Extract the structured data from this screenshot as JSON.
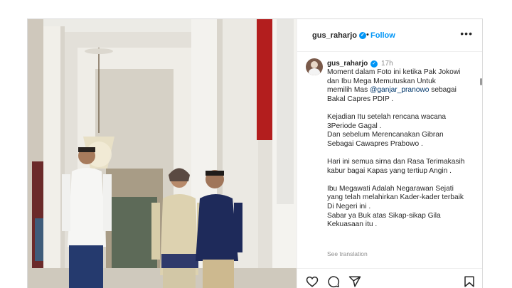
{
  "post": {
    "username": "gus_raharjo",
    "follow_label": "Follow",
    "dot_separator": "•",
    "more_label": "•••"
  },
  "caption": {
    "username": "gus_raharjo",
    "time": "17h",
    "mention": "@ganjar_pranowo",
    "lines": [
      "Moment dalam Foto ini ketika Pak Jokowi",
      "dan Ibu Mega Memutuskan Untuk",
      "memilih Mas ",
      " sebagai",
      "Bakal Capres PDIP .",
      "Kejadian Itu setelah rencana wacana",
      "3Periode Gagal .",
      "Dan sebelum Merencanakan Gibran",
      "Sebagai Cawapres Prabowo .",
      "Hari ini semua sirna dan Rasa Terimakasih",
      "kabur bagai Kapas yang tertiup Angin .",
      "Ibu Megawati Adalah Negarawan Sejati",
      "yang telah melahirkan Kader-kader terbaik",
      "Di Negeri ini .",
      "Sabar ya Buk atas Sikap-sikap Gila",
      "Kekuasaan itu ."
    ],
    "see_translation": "See translation"
  },
  "actions": {
    "like_icon": "heart-icon",
    "comment_icon": "comment-icon",
    "share_icon": "share-icon",
    "save_icon": "bookmark-icon"
  },
  "colors": {
    "accent": "#0095f6",
    "mention": "#00376b",
    "muted": "#8e8e8e",
    "text": "#262626"
  }
}
